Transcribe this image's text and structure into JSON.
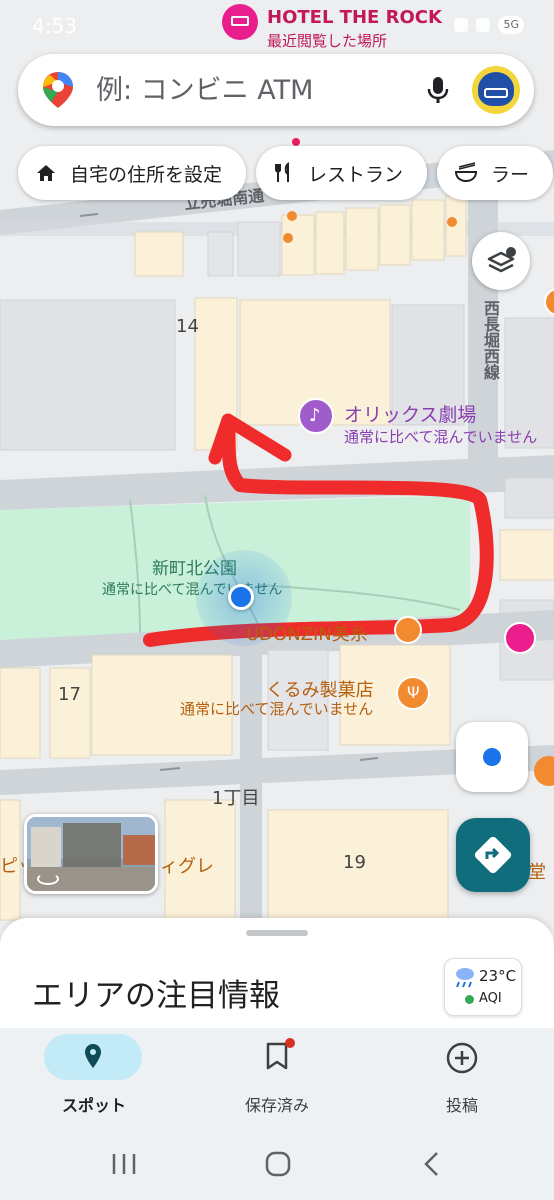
{
  "status_bar": {
    "time": "4:53",
    "network_badge": "5G"
  },
  "search": {
    "placeholder": "例: コンビニ ATM"
  },
  "chips": [
    {
      "label": "自宅の住所を設定",
      "icon": "home-icon"
    },
    {
      "label": "レストラン",
      "icon": "fork-knife-icon"
    },
    {
      "label": "ラー",
      "icon": "ramen-bowl-icon"
    }
  ],
  "map": {
    "hotel": {
      "name": "HOTEL THE ROCK",
      "subtitle": "最近閲覧した場所"
    },
    "theater": {
      "name": "オリックス劇場",
      "status": "通常に比べて混んでいません"
    },
    "park": {
      "name": "新町北公園",
      "status": "通常に比べて混んでいません"
    },
    "bakery": {
      "name": "くるみ製菓店",
      "status": "通常に比べて混んでいません"
    },
    "udon": {
      "name": "UDONZIN美糸"
    },
    "road_north": "立売堀南通",
    "road_east": "西長堀西線",
    "chome": "1丁目",
    "block_14": "14",
    "block_17": "17",
    "block_19": "19",
    "left_partial": "ピッ",
    "mid_partial": "ィグレ",
    "right_partial": "食堂",
    "right_partial_2": "ン"
  },
  "sheet": {
    "title": "エリアの注目情報"
  },
  "weather": {
    "temp": "23°C",
    "aqi": "AQI"
  },
  "nav": {
    "explore": "スポット",
    "saved": "保存済み",
    "contribute": "投稿"
  },
  "colors": {
    "park": "#c9f0d9",
    "annotation_red": "#ef2b2b",
    "location_blue": "#1a73e8",
    "directions_teal": "#0f6d7c",
    "nav_active": "#c3ebf7"
  }
}
